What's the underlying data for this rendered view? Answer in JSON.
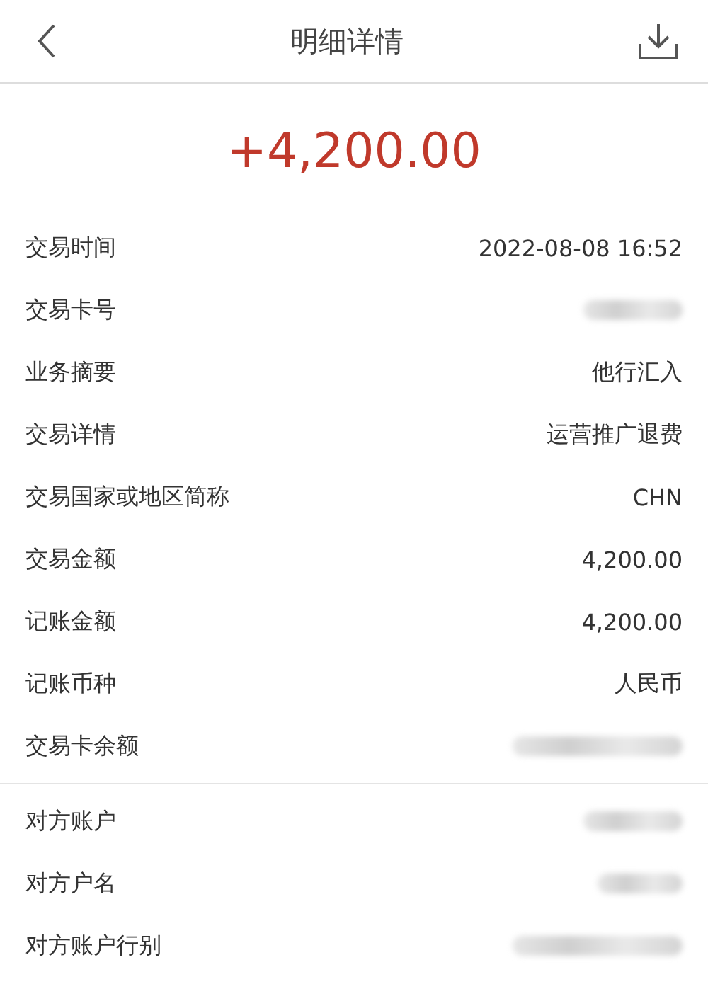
{
  "header": {
    "title": "明细详情"
  },
  "amount": "+4,200.00",
  "sections": [
    {
      "rows": [
        {
          "label": "交易时间",
          "kind": "text",
          "value": "2022-08-08 16:52"
        },
        {
          "label": "交易卡号",
          "kind": "redacted"
        },
        {
          "label": "业务摘要",
          "kind": "text",
          "value": "他行汇入"
        },
        {
          "label": "交易详情",
          "kind": "text",
          "value": "运营推广退费"
        },
        {
          "label": "交易国家或地区简称",
          "kind": "text",
          "value": "CHN"
        },
        {
          "label": "交易金额",
          "kind": "text",
          "value": "4,200.00"
        },
        {
          "label": "记账金额",
          "kind": "text",
          "value": "4,200.00"
        },
        {
          "label": "记账币种",
          "kind": "text",
          "value": "人民币"
        },
        {
          "label": "交易卡余额",
          "kind": "redacted"
        }
      ]
    },
    {
      "rows": [
        {
          "label": "对方账户",
          "kind": "redacted"
        },
        {
          "label": "对方户名",
          "kind": "redacted"
        },
        {
          "label": "对方账户行别",
          "kind": "redacted"
        }
      ]
    }
  ]
}
